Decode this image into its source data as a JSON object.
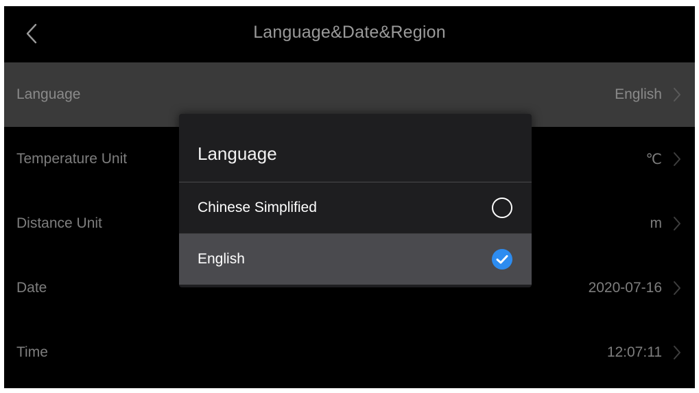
{
  "header": {
    "title": "Language&Date&Region",
    "back_icon": "chevron-left-icon"
  },
  "settings": [
    {
      "label": "Language",
      "value": "English",
      "highlighted": true
    },
    {
      "label": "Temperature Unit",
      "value": "℃",
      "highlighted": false
    },
    {
      "label": "Distance Unit",
      "value": "m",
      "highlighted": false
    },
    {
      "label": "Date",
      "value": "2020-07-16",
      "highlighted": false
    },
    {
      "label": "Time",
      "value": "12:07:11",
      "highlighted": false
    }
  ],
  "dialog": {
    "title": "Language",
    "options": [
      {
        "label": "Chinese Simplified",
        "selected": false
      },
      {
        "label": "English",
        "selected": true
      }
    ]
  },
  "colors": {
    "background": "#000000",
    "highlight_row": "#3a3a3a",
    "dialog_bg": "#1e1e20",
    "selected_option_bg": "#4a4a4e",
    "accent": "#2d8cf0"
  }
}
